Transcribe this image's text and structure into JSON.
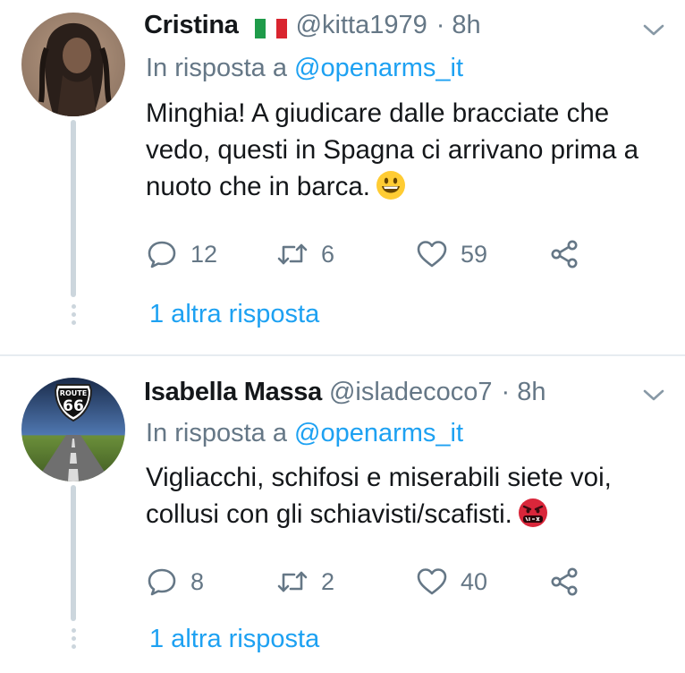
{
  "tweets": [
    {
      "name": "Cristina",
      "handle": "@kitta1979",
      "time": "· 8h",
      "reply_prefix": "In risposta a ",
      "reply_mention": "@openarms_it",
      "text": "Minghia! A giudicare dalle bracciate che vedo, questi in Spagna ci arrivano prima a nuoto che in barca.",
      "emoji": "grinning-face",
      "replies": "12",
      "retweets": "6",
      "likes": "59",
      "more_replies": "1 altra risposta"
    },
    {
      "name": "Isabella Massa",
      "handle": "@isladecoco7",
      "time": "· 8h",
      "reply_prefix": "In risposta a ",
      "reply_mention": "@openarms_it",
      "text": "Vigliacchi, schifosi e miserabili siete voi, collusi con gli schiavisti/scafisti.",
      "emoji": "face-with-symbols-on-mouth",
      "avatar_sign_top": "ROUTE",
      "avatar_sign_number": "66",
      "replies": "8",
      "retweets": "2",
      "likes": "40",
      "more_replies": "1 altra risposta"
    }
  ],
  "colors": {
    "link": "#1da1f2",
    "secondary": "#657786",
    "thread_line": "#ccd6dd",
    "divider": "#e6ecf0"
  }
}
